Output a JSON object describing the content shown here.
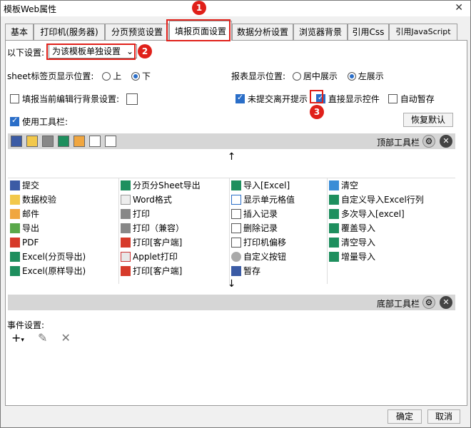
{
  "window": {
    "title": "模板Web属性",
    "close": "✕"
  },
  "tabs": [
    "基本",
    "打印机(服务器)",
    "分页预览设置",
    "填报页面设置",
    "数据分析设置",
    "浏览器背景",
    "引用Css",
    "引用JavaScript"
  ],
  "settings": {
    "label": "以下设置:",
    "mode_value": "为该模板单独设置",
    "sheet_label": "sheet标签页显示位置:",
    "sheet_opts": [
      "上",
      "下"
    ],
    "report_label": "报表显示位置:",
    "report_opts": [
      "居中展示",
      "左展示"
    ],
    "fill_bg": "填报当前编辑行背景设置:",
    "unsubmit": "未提交离开提示",
    "direct_ctrl": "直接显示控件",
    "autosave": "自动暂存",
    "use_toolbar": "使用工具栏:",
    "restore": "恢复默认"
  },
  "top_toolbar_label": "顶部工具栏",
  "bottom_toolbar_label": "底部工具栏",
  "up_arrow": "↑",
  "down_arrow": "↓",
  "grid": [
    [
      "提交",
      "分页分Sheet导出",
      "导入[Excel]",
      "清空"
    ],
    [
      "数据校验",
      "Word格式",
      "显示单元格值",
      "自定义导入Excel行列"
    ],
    [
      "邮件",
      "打印",
      "插入记录",
      "多次导入[excel]"
    ],
    [
      "导出",
      "打印（兼容）",
      "删除记录",
      "覆盖导入"
    ],
    [
      "PDF",
      "打印[客户端]",
      "打印机偏移",
      "清空导入"
    ],
    [
      "Excel(分页导出)",
      "Applet打印",
      "自定义按钮",
      "增量导入"
    ],
    [
      "Excel(原样导出)",
      "打印[客户端]",
      "暂存",
      ""
    ]
  ],
  "events_label": "事件设置:",
  "event_tools": [
    "+",
    "✎",
    "✕"
  ],
  "footer": {
    "ok": "确定",
    "cancel": "取消"
  },
  "badges": [
    "1",
    "2",
    "3"
  ],
  "accent": "#e0201a"
}
